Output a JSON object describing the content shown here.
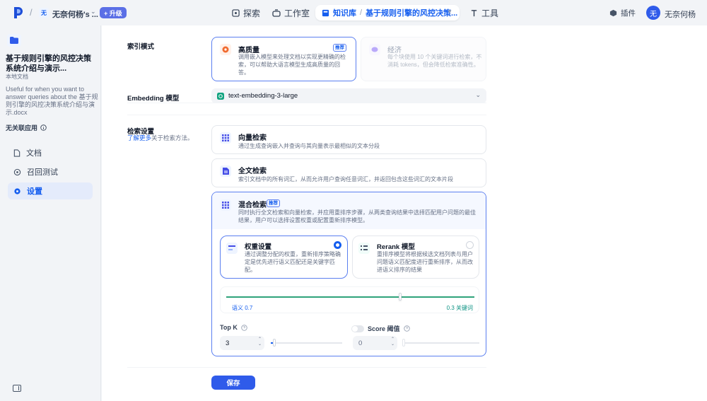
{
  "top": {
    "workspace_avatar": "无",
    "workspace_name": "无奈何杨's ...",
    "upgrade": "+ 升级",
    "nav": {
      "explore": "探索",
      "studio": "工作室",
      "knowledge": "知识库",
      "current_doc": "基于规则引擎的风控决策...",
      "tools": "工具"
    },
    "plugins": "插件",
    "user_avatar": "无",
    "user_name": "无奈何杨"
  },
  "sidebar": {
    "title": "基于规则引擎的风控决策系统介绍与演示...",
    "type": "本地文档",
    "description": "Useful for when you want to answer queries about the 基于规则引擎的风控决策系统介绍与演示.docx",
    "no_apps": "无关联应用",
    "items": [
      {
        "label": "文档",
        "icon": "document-icon"
      },
      {
        "label": "召回测试",
        "icon": "target-icon"
      },
      {
        "label": "设置",
        "icon": "gear-icon"
      }
    ]
  },
  "settings": {
    "index_mode_label": "索引模式",
    "high_quality": {
      "title": "高质量",
      "badge": "推荐",
      "desc": "调用嵌入模型来处理文档以实现更精确的检索，可以帮助大语言模型生成高质量的回答。"
    },
    "economy": {
      "title": "经济",
      "desc": "每个块使用 10 个关键词进行检索，不消耗 tokens，但会降低检索准确性。"
    },
    "embedding_label": "Embedding 模型",
    "embedding_model": "text-embedding-3-large",
    "retrieval_label": "检索设置",
    "learn_more": "了解更多",
    "learn_more_suffix": "关于检索方法。",
    "vector": {
      "title": "向量检索",
      "desc": "通过生成查询嵌入并查询与其向量表示最相似的文本分段"
    },
    "fulltext": {
      "title": "全文检索",
      "desc": "索引文档中的所有词汇，从而允许用户查询任意词汇，并返回包含这些词汇的文本片段"
    },
    "hybrid": {
      "title": "混合检索",
      "badge": "推荐",
      "desc": "同时执行全文检索和向量检索，并应用重排序步骤，从两类查询结果中选择匹配用户问题的最佳结果，用户可以选择设置权重或配置重新排序模型。"
    },
    "weighted": {
      "title": "权重设置",
      "desc": "通过调整分配的权重，重新排序策略确定是优先进行语义匹配还是关键字匹配。"
    },
    "rerank": {
      "title": "Rerank 模型",
      "desc": "重排序模型将根据候选文档列表与用户问题语义匹配度进行重新排序，从而改进语义排序的结果"
    },
    "semantic_label": "语义 0.7",
    "keyword_label": "0.3 关键词",
    "semantic_weight": 0.7,
    "topk_label": "Top K",
    "topk_value": "3",
    "topk_fraction": 0.05,
    "score_label": "Score 阈值",
    "score_value": "0",
    "score_fraction": 0.0,
    "save": "保存"
  },
  "colors": {
    "accent": "#155eef",
    "weight_track": "#2fa37a"
  }
}
